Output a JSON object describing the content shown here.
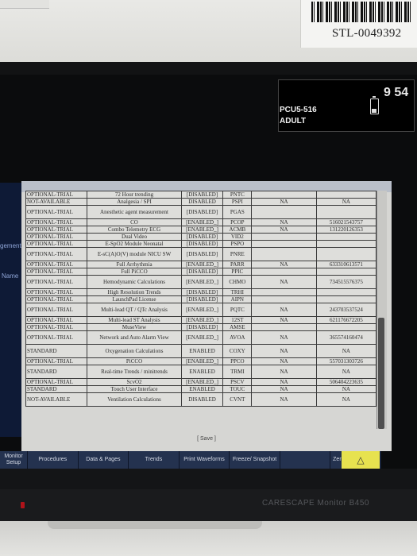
{
  "asset_label": {
    "id": "STL-0049392"
  },
  "header": {
    "location": "PCU5-516",
    "category": "ADULT",
    "time": "9 54",
    "battery_icon": "battery-low-icon"
  },
  "side_labels": {
    "label_1": "gement",
    "label_2": "Name"
  },
  "licenses": {
    "rows": [
      {
        "status": "OPTIONAL-TRIAL",
        "name": "72 Hour trending",
        "state": "[DISABLED]",
        "code": "PNTC",
        "extra1": "",
        "extra2": ""
      },
      {
        "status": "NOT-AVAILABLE",
        "name": "Analgesia / SPI",
        "state": "DISABLED",
        "code": "PSPI",
        "extra1": "NA",
        "extra2": "NA"
      },
      {
        "status": "OPTIONAL-TRIAL",
        "name": "Anesthetic agent measurement",
        "state": "[DISABLED]",
        "code": "PGAS",
        "extra1": "",
        "extra2": ""
      },
      {
        "status": "OPTIONAL-TRIAL",
        "name": "CO",
        "state": "[ENABLED_]",
        "code": "PCOP",
        "extra1": "NA",
        "extra2": "516021543757"
      },
      {
        "status": "OPTIONAL-TRIAL",
        "name": "Combo Telemetry ECG",
        "state": "[ENABLED_]",
        "code": "ACMB",
        "extra1": "NA",
        "extra2": "131220126353"
      },
      {
        "status": "OPTIONAL-TRIAL",
        "name": "Dual Video",
        "state": "[DISABLED]",
        "code": "VID2",
        "extra1": "",
        "extra2": ""
      },
      {
        "status": "OPTIONAL-TRIAL",
        "name": "E-SpO2 Module Neonatal",
        "state": "[DISABLED]",
        "code": "PSPO",
        "extra1": "",
        "extra2": ""
      },
      {
        "status": "OPTIONAL-TRIAL",
        "name": "E-sC(A)O(V) module NICU SW",
        "state": "[DISABLED]",
        "code": "PNRE",
        "extra1": "",
        "extra2": ""
      },
      {
        "status": "OPTIONAL-TRIAL",
        "name": "Full Arrhythmia",
        "state": "[ENABLED_]",
        "code": "PARR",
        "extra1": "NA",
        "extra2": "633310613571"
      },
      {
        "status": "OPTIONAL-TRIAL",
        "name": "Full PiCCO",
        "state": "[DISABLED]",
        "code": "PPIC",
        "extra1": "",
        "extra2": ""
      },
      {
        "status": "OPTIONAL-TRIAL",
        "name": "Hemodynamic Calculations",
        "state": "[ENABLED_]",
        "code": "CHMO",
        "extra1": "NA",
        "extra2": "734515576375"
      },
      {
        "status": "OPTIONAL-TRIAL",
        "name": "High Resolution Trends",
        "state": "[DISABLED]",
        "code": "TRHI",
        "extra1": "",
        "extra2": ""
      },
      {
        "status": "OPTIONAL-TRIAL",
        "name": "LaunchPad License",
        "state": "[DISABLED]",
        "code": "AIPN",
        "extra1": "",
        "extra2": ""
      },
      {
        "status": "OPTIONAL-TRIAL",
        "name": "Multi-lead QT / QTc Analysis",
        "state": "[ENABLED_]",
        "code": "PQTC",
        "extra1": "NA",
        "extra2": "243703537524"
      },
      {
        "status": "OPTIONAL-TRIAL",
        "name": "Multi-lead ST Analysis",
        "state": "[ENABLED_]",
        "code": "12ST",
        "extra1": "NA",
        "extra2": "621176672205"
      },
      {
        "status": "OPTIONAL-TRIAL",
        "name": "MuseView",
        "state": "[DISABLED]",
        "code": "AMSE",
        "extra1": "",
        "extra2": ""
      },
      {
        "status": "OPTIONAL-TRIAL",
        "name": "Network and Auto Alarm View",
        "state": "[ENABLED_]",
        "code": "AVOA",
        "extra1": "NA",
        "extra2": "365574160474"
      },
      {
        "status": "STANDARD",
        "name": "Oxygenation Calculations",
        "state": "ENABLED",
        "code": "COXY",
        "extra1": "NA",
        "extra2": "NA"
      },
      {
        "status": "OPTIONAL-TRIAL",
        "name": "PiCCO",
        "state": "[ENABLED_]",
        "code": "PPCO",
        "extra1": "NA",
        "extra2": "557031303726"
      },
      {
        "status": "STANDARD",
        "name": "Real-time Trends / minitrends",
        "state": "ENABLED",
        "code": "TRMI",
        "extra1": "NA",
        "extra2": "NA"
      },
      {
        "status": "OPTIONAL-TRIAL",
        "name": "ScvO2",
        "state": "[ENABLED_]",
        "code": "PSCV",
        "extra1": "NA",
        "extra2": "506404223635"
      },
      {
        "status": "STANDARD",
        "name": "Touch User Interface",
        "state": "ENABLED",
        "code": "TOUC",
        "extra1": "NA",
        "extra2": "NA"
      },
      {
        "status": "NOT-AVAILABLE",
        "name": "Ventilation Calculations",
        "state": "DISABLED",
        "code": "CVNT",
        "extra1": "NA",
        "extra2": "NA"
      }
    ],
    "save_label": "[ Save ]"
  },
  "menu": {
    "items": [
      "Monitor Setup",
      "Procedures",
      "Data & Pages",
      "Trends",
      "Print Waveforms",
      "Freeze/ Snapshot",
      "",
      "Zero All Pressures"
    ],
    "alarm_icon": "alarm-audio-pause-icon"
  },
  "device": {
    "brand": "CARESCAPE Monitor B450"
  }
}
